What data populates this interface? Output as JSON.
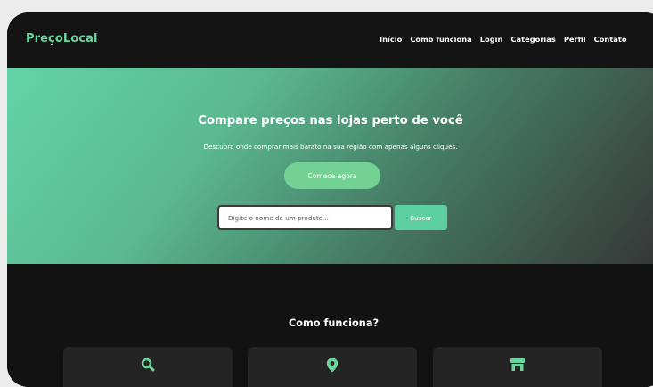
{
  "app": {
    "brand": "PreçoLocal",
    "accent": "#6ad49c"
  },
  "nav": {
    "links": [
      "Início",
      "Como funciona",
      "Login",
      "Categorias",
      "Perfil",
      "Contato"
    ]
  },
  "hero": {
    "title": "Compare preços nas lojas perto de você",
    "subtitle": "Descubra onde comprar mais barato na sua região com apenas alguns cliques.",
    "cta_label": "Comece agora",
    "search_placeholder": "Digite o nome de um produto...",
    "search_button": "Buscar"
  },
  "how": {
    "title": "Como funciona?",
    "cards": [
      {
        "icon": "search-icon"
      },
      {
        "icon": "map-pin-icon"
      },
      {
        "icon": "store-icon"
      }
    ]
  }
}
